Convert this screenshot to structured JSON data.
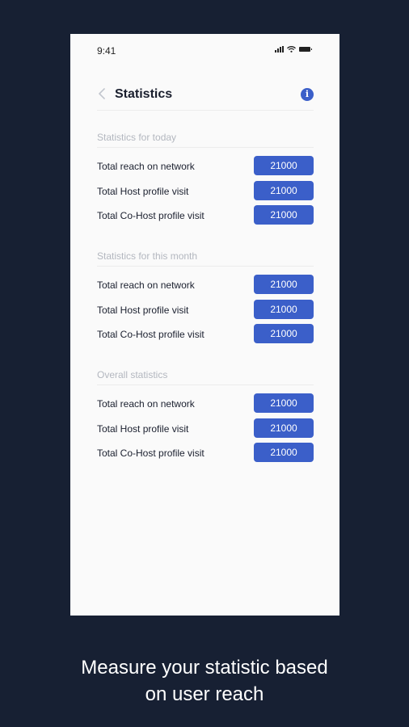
{
  "status": {
    "time": "9:41"
  },
  "header": {
    "title": "Statistics",
    "info_label": "i"
  },
  "sections": [
    {
      "title": "Statistics for today",
      "rows": [
        {
          "label": "Total reach on network",
          "value": "21000"
        },
        {
          "label": "Total Host profile visit",
          "value": "21000"
        },
        {
          "label": "Total Co-Host profile visit",
          "value": "21000"
        }
      ]
    },
    {
      "title": "Statistics for this month",
      "rows": [
        {
          "label": "Total reach on network",
          "value": "21000"
        },
        {
          "label": "Total Host profile visit",
          "value": "21000"
        },
        {
          "label": "Total Co-Host profile visit",
          "value": "21000"
        }
      ]
    },
    {
      "title": "Overall statistics",
      "rows": [
        {
          "label": "Total reach on network",
          "value": "21000"
        },
        {
          "label": "Total Host profile visit",
          "value": "21000"
        },
        {
          "label": "Total Co-Host profile visit",
          "value": "21000"
        }
      ]
    }
  ],
  "caption": {
    "line1": "Measure your statistic based",
    "line2": "on user reach"
  },
  "colors": {
    "background": "#172033",
    "accent": "#3b5fc9"
  }
}
